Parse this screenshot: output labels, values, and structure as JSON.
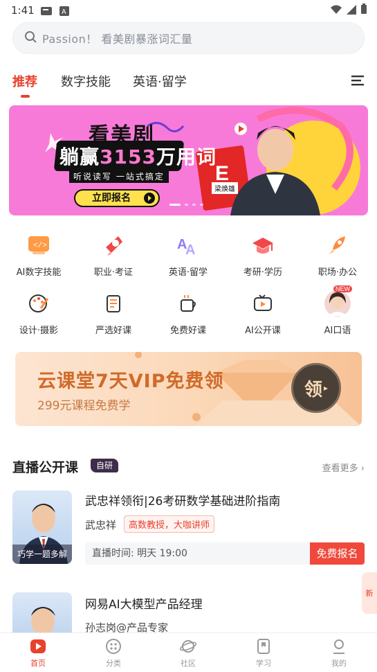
{
  "status_bar": {
    "time": "1:41"
  },
  "search": {
    "placeholder": "Passion！ 看美剧暴涨词汇量"
  },
  "tabs": [
    {
      "label": "推荐",
      "active": true
    },
    {
      "label": "数字技能",
      "active": false
    },
    {
      "label": "英语·留学",
      "active": false
    }
  ],
  "banner": {
    "title": "看美剧",
    "headline_prefix": "躺赢",
    "headline_number": "3153",
    "headline_suffix": "万用词",
    "subtitle": "听说读写 一站式搞定",
    "button": "立即报名",
    "teacher_name": "梁焕雄"
  },
  "categories": [
    {
      "label": "AI数字技能",
      "icon": "code-screen-icon"
    },
    {
      "label": "职业·考证",
      "icon": "certificate-icon"
    },
    {
      "label": "英语·留学",
      "icon": "letters-icon"
    },
    {
      "label": "考研·学历",
      "icon": "graduation-cap-icon"
    },
    {
      "label": "职场·办公",
      "icon": "rocket-icon"
    },
    {
      "label": "设计·摄影",
      "icon": "palette-icon"
    },
    {
      "label": "严选好课",
      "icon": "document-icon"
    },
    {
      "label": "免费好课",
      "icon": "cup-icon"
    },
    {
      "label": "AI公开课",
      "icon": "tv-icon"
    },
    {
      "label": "AI口语",
      "icon": "avatar-icon",
      "badge": "NEW"
    }
  ],
  "vip": {
    "title": "云课堂7天VIP免费领",
    "subtitle": "299元课程免费学",
    "button": "领"
  },
  "live_section": {
    "title": "直播公开课",
    "badge": "自研",
    "more": "查看更多"
  },
  "courses": [
    {
      "title": "武忠祥领衔|26考研数学基础进阶指南",
      "teacher": "武忠祥",
      "tag": "高数教授，大咖讲师",
      "time": "直播时间: 明天  19:00",
      "button": "免费报名",
      "cover_caption": "巧学一题多解"
    },
    {
      "title": "网易AI大模型产品经理",
      "teacher": "孙志岗@产品专家"
    }
  ],
  "float_tab": "新",
  "bottom_nav": [
    {
      "label": "首页",
      "active": true
    },
    {
      "label": "分类",
      "active": false
    },
    {
      "label": "社区",
      "active": false
    },
    {
      "label": "学习",
      "active": false
    },
    {
      "label": "我的",
      "active": false
    }
  ],
  "colors": {
    "accent": "#e8412c",
    "banner_bg": "#f87ad8",
    "vip_text": "#d06a2a"
  }
}
